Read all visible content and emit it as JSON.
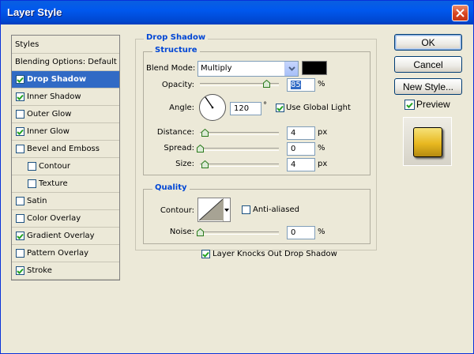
{
  "window": {
    "title": "Layer Style"
  },
  "styles_list": {
    "header": "Styles",
    "items": [
      {
        "label": "Blending Options: Default",
        "checkbox": false,
        "checked": false,
        "selected": false,
        "indent": false
      },
      {
        "label": "Drop Shadow",
        "checkbox": true,
        "checked": true,
        "selected": true,
        "indent": false
      },
      {
        "label": "Inner Shadow",
        "checkbox": true,
        "checked": true,
        "selected": false,
        "indent": false
      },
      {
        "label": "Outer Glow",
        "checkbox": true,
        "checked": false,
        "selected": false,
        "indent": false
      },
      {
        "label": "Inner Glow",
        "checkbox": true,
        "checked": true,
        "selected": false,
        "indent": false
      },
      {
        "label": "Bevel and Emboss",
        "checkbox": true,
        "checked": false,
        "selected": false,
        "indent": false
      },
      {
        "label": "Contour",
        "checkbox": true,
        "checked": false,
        "selected": false,
        "indent": true
      },
      {
        "label": "Texture",
        "checkbox": true,
        "checked": false,
        "selected": false,
        "indent": true
      },
      {
        "label": "Satin",
        "checkbox": true,
        "checked": false,
        "selected": false,
        "indent": false
      },
      {
        "label": "Color Overlay",
        "checkbox": true,
        "checked": false,
        "selected": false,
        "indent": false
      },
      {
        "label": "Gradient Overlay",
        "checkbox": true,
        "checked": true,
        "selected": false,
        "indent": false
      },
      {
        "label": "Pattern Overlay",
        "checkbox": true,
        "checked": false,
        "selected": false,
        "indent": false
      },
      {
        "label": "Stroke",
        "checkbox": true,
        "checked": true,
        "selected": false,
        "indent": false
      }
    ]
  },
  "drop_shadow": {
    "section_title": "Drop Shadow",
    "structure": {
      "title": "Structure",
      "blend_mode_label": "Blend Mode:",
      "blend_mode_value": "Multiply",
      "shadow_color": "#000000",
      "opacity_label": "Opacity:",
      "opacity_value": "85",
      "opacity_unit": "%",
      "angle_label": "Angle:",
      "angle_value": "120",
      "angle_unit": "°",
      "use_global_light_label": "Use Global Light",
      "use_global_light_checked": true,
      "distance_label": "Distance:",
      "distance_value": "4",
      "distance_unit": "px",
      "spread_label": "Spread:",
      "spread_value": "0",
      "spread_unit": "%",
      "size_label": "Size:",
      "size_value": "4",
      "size_unit": "px"
    },
    "quality": {
      "title": "Quality",
      "contour_label": "Contour:",
      "anti_aliased_label": "Anti-aliased",
      "anti_aliased_checked": false,
      "noise_label": "Noise:",
      "noise_value": "0",
      "noise_unit": "%"
    },
    "knockout_label": "Layer Knocks Out Drop Shadow",
    "knockout_checked": true
  },
  "buttons": {
    "ok": "OK",
    "cancel": "Cancel",
    "new_style": "New Style...",
    "preview_label": "Preview",
    "preview_checked": true
  },
  "colors": {
    "titlebar": "#0054e3",
    "selection": "#316ac5",
    "group_title": "#0046d5",
    "dialog_bg": "#ece9d8",
    "preview_gold": "#e8b820"
  },
  "icons": {
    "close": "close-x-icon",
    "dropdown": "chevron-down-icon",
    "check": "checkmark-icon",
    "angle": "angle-dial-icon",
    "contour": "contour-curve-icon"
  }
}
